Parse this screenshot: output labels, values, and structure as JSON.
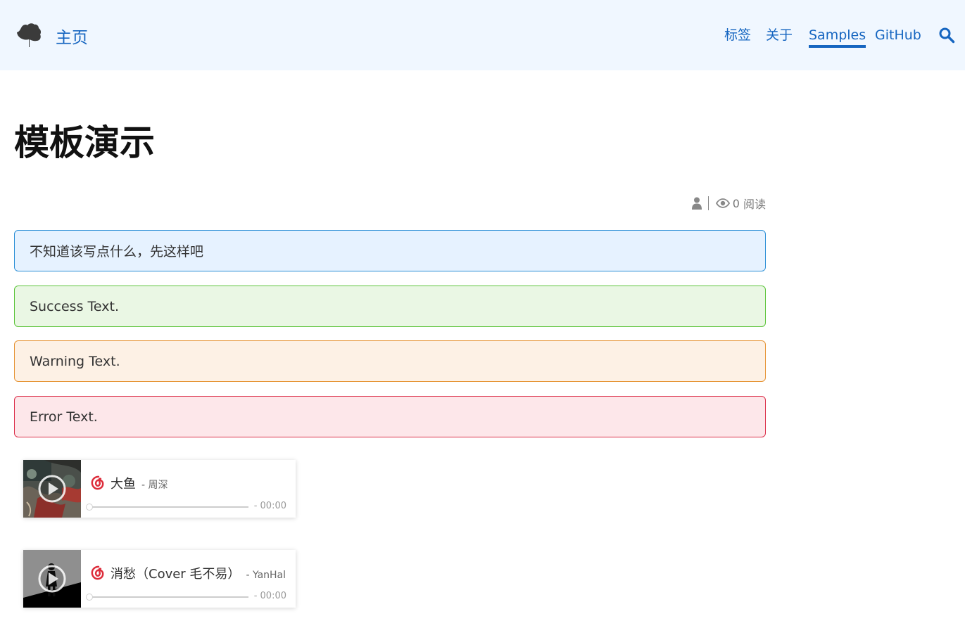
{
  "header": {
    "logo_icon": "ginkgo-leaf-icon",
    "home_label": "主页",
    "nav": [
      {
        "label": "标签",
        "active": false
      },
      {
        "label": "关于",
        "active": false
      },
      {
        "label": "Samples",
        "active": true
      },
      {
        "label": "GitHub",
        "active": false
      }
    ],
    "search_icon": "search-icon",
    "accent_color": "#1565c0",
    "background": "#f0f7ff"
  },
  "post": {
    "title": "模板演示",
    "meta": {
      "author_icon": "user-icon",
      "views_icon": "eye-icon",
      "views_count": "0",
      "views_label": "阅读"
    }
  },
  "alerts": [
    {
      "type": "info",
      "text": "不知道该写点什么，先这样吧",
      "border": "#2b8fd6",
      "bg": "#e6f2ff"
    },
    {
      "type": "success",
      "text": "Success Text.",
      "border": "#5cc43a",
      "bg": "#eaf7e4"
    },
    {
      "type": "warning",
      "text": "Warning Text.",
      "border": "#e69435",
      "bg": "#fdf1e5"
    },
    {
      "type": "error",
      "text": "Error Text.",
      "border": "#dc2f4a",
      "bg": "#fde7ea"
    }
  ],
  "players": [
    {
      "title": "大鱼",
      "artist": "- 周深",
      "time": "- 00:00",
      "provider_icon": "netease-music-icon",
      "play_icon": "play-icon",
      "progress": 0
    },
    {
      "title": "消愁（Cover 毛不易）",
      "artist": "- YanHal",
      "time": "- 00:00",
      "provider_icon": "netease-music-icon",
      "play_icon": "play-icon",
      "progress": 0
    }
  ]
}
